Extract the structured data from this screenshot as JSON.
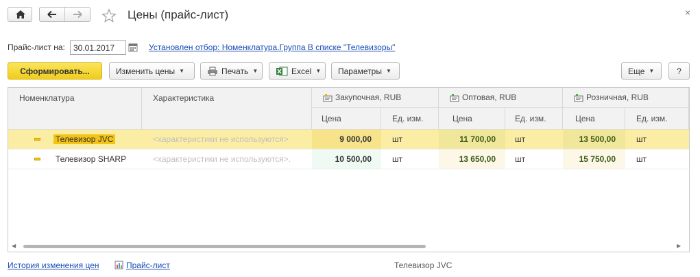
{
  "window": {
    "title": "Цены (прайс-лист)",
    "close_glyph": "×"
  },
  "filter": {
    "label": "Прайс-лист на:",
    "date_value": "30.01.2017",
    "link_text": "Установлен отбор: Номенклатура.Группа В списке \"Телевизоры\""
  },
  "toolbar": {
    "generate_label": "Сформировать...",
    "change_prices_label": "Изменить цены",
    "print_label": "Печать",
    "excel_label": "Excel",
    "params_label": "Параметры",
    "more_label": "Еще",
    "help_label": "?"
  },
  "grid": {
    "headers": {
      "nomenclature": "Номенклатура",
      "characteristic": "Характеристика",
      "purchase": "Закупочная, RUB",
      "wholesale": "Оптовая, RUB",
      "retail": "Розничная, RUB",
      "price": "Цена",
      "unit": "Ед. изм."
    },
    "rows": [
      {
        "name": "Телевизор JVC",
        "characteristic": "<характеристики не используются>",
        "purchase_price": "9 000,00",
        "purchase_unit": "шт",
        "wholesale_price": "11 700,00",
        "wholesale_unit": "шт",
        "retail_price": "13 500,00",
        "retail_unit": "шт"
      },
      {
        "name": "Телевизор SHARP",
        "characteristic": "<характеристики не используются>.",
        "purchase_price": "10 500,00",
        "purchase_unit": "шт",
        "wholesale_price": "13 650,00",
        "wholesale_unit": "шт",
        "retail_price": "15 750,00",
        "retail_unit": "шт"
      }
    ]
  },
  "footer": {
    "history_link": "История изменения цен",
    "pricelist_link": "Прайс-лист",
    "current_item": "Телевизор JVC"
  },
  "colors": {
    "primary_button": "#f0cd1c",
    "selected_row": "#fbeda4",
    "link": "#1a4bb5"
  }
}
